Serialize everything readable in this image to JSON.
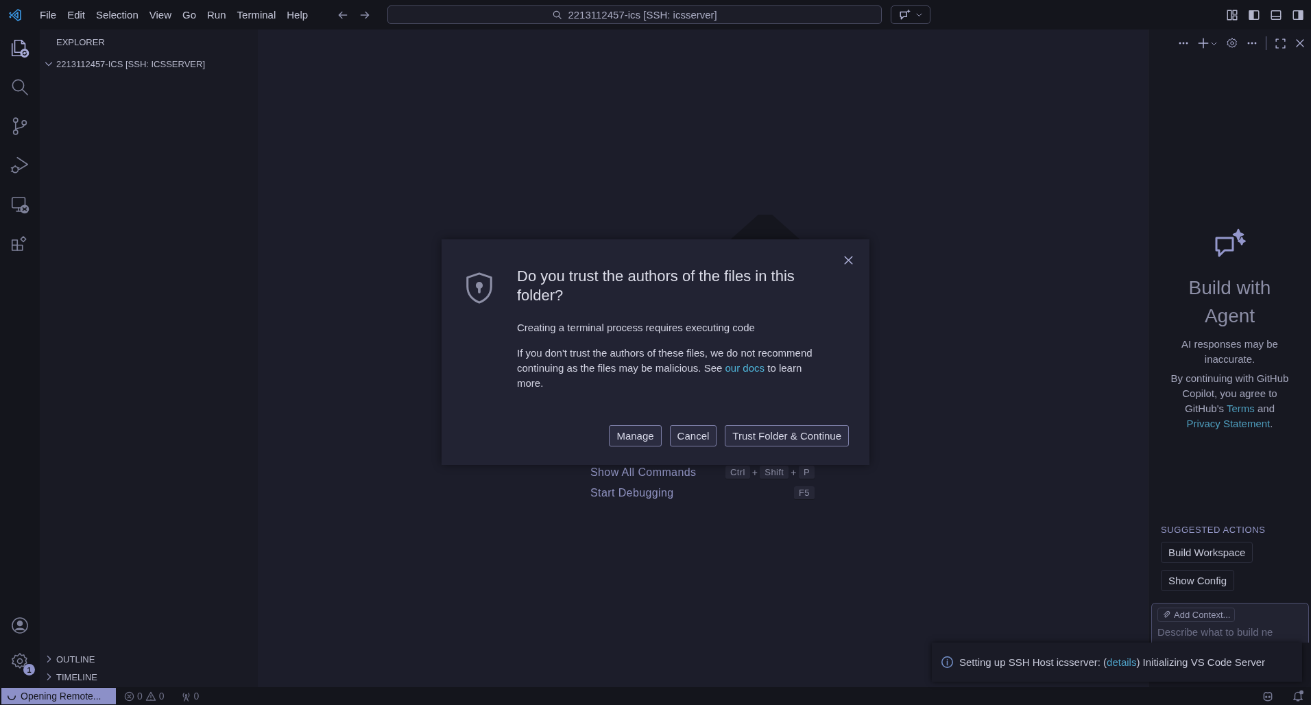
{
  "title_bar": {
    "menu": [
      "File",
      "Edit",
      "Selection",
      "View",
      "Go",
      "Run",
      "Terminal",
      "Help"
    ],
    "command_center": "2213112457-ics [SSH: icsserver]"
  },
  "activity_bar": {
    "items": [
      {
        "kind": "explorer",
        "selected": true
      },
      {
        "kind": "search",
        "selected": false
      },
      {
        "kind": "source-control",
        "selected": false
      },
      {
        "kind": "run-debug",
        "selected": false
      },
      {
        "kind": "remote",
        "selected": false
      },
      {
        "kind": "extensions",
        "selected": false
      }
    ],
    "bottom": [
      {
        "kind": "account"
      },
      {
        "kind": "manage",
        "badge": "1"
      }
    ]
  },
  "sidebar": {
    "title": "EXPLORER",
    "folder": {
      "label": "2213112457-ICS [SSH: ICSSERVER]",
      "expanded": true
    },
    "sections": [
      {
        "label": "OUTLINE",
        "expanded": false
      },
      {
        "label": "TIMELINE",
        "expanded": false
      }
    ]
  },
  "editor": {
    "shortcuts": [
      {
        "label": "Show All Commands",
        "keys": [
          {
            "kind": "key",
            "text": "Ctrl"
          },
          {
            "kind": "plus",
            "text": "+"
          },
          {
            "kind": "key",
            "text": "Shift"
          },
          {
            "kind": "plus",
            "text": "+"
          },
          {
            "kind": "key",
            "text": "P"
          }
        ]
      },
      {
        "label": "Start Debugging",
        "keys": [
          {
            "kind": "key",
            "text": "F5"
          }
        ]
      }
    ]
  },
  "dialog": {
    "title": "Do you trust the authors of the files in this folder?",
    "message": "Creating a terminal process requires executing code",
    "detail": [
      {
        "kind": "text",
        "text": "If you don't trust the authors of these files, we do not recommend continuing as the files may be malicious. See "
      },
      {
        "kind": "link",
        "text": "our docs"
      },
      {
        "kind": "text",
        "text": " to learn more."
      }
    ],
    "buttons": [
      "Manage",
      "Cancel",
      "Trust Folder & Continue"
    ]
  },
  "chat": {
    "title": "Build with Agent",
    "disclaimer": "AI responses may be inaccurate.",
    "terms": [
      {
        "kind": "text",
        "text": "By continuing with GitHub Copilot, you agree to GitHub's "
      },
      {
        "kind": "link",
        "text": "Terms"
      },
      {
        "kind": "text",
        "text": " and "
      },
      {
        "kind": "link",
        "text": "Privacy Statement"
      },
      {
        "kind": "text",
        "text": "."
      }
    ],
    "suggested_title": "SUGGESTED ACTIONS",
    "suggested": [
      "Build Workspace",
      "Show Config"
    ],
    "input": {
      "context_button": "Add Context...",
      "placeholder": "Describe what to build ne"
    }
  },
  "notification": {
    "message": [
      {
        "kind": "text",
        "text": "Setting up SSH Host icsserver: ("
      },
      {
        "kind": "link",
        "text": "details"
      },
      {
        "kind": "text",
        "text": ") Initializing VS Code Server"
      }
    ]
  },
  "status_bar": {
    "remote": "Opening Remote...",
    "errors": "0",
    "warnings": "0",
    "ports": "0"
  }
}
